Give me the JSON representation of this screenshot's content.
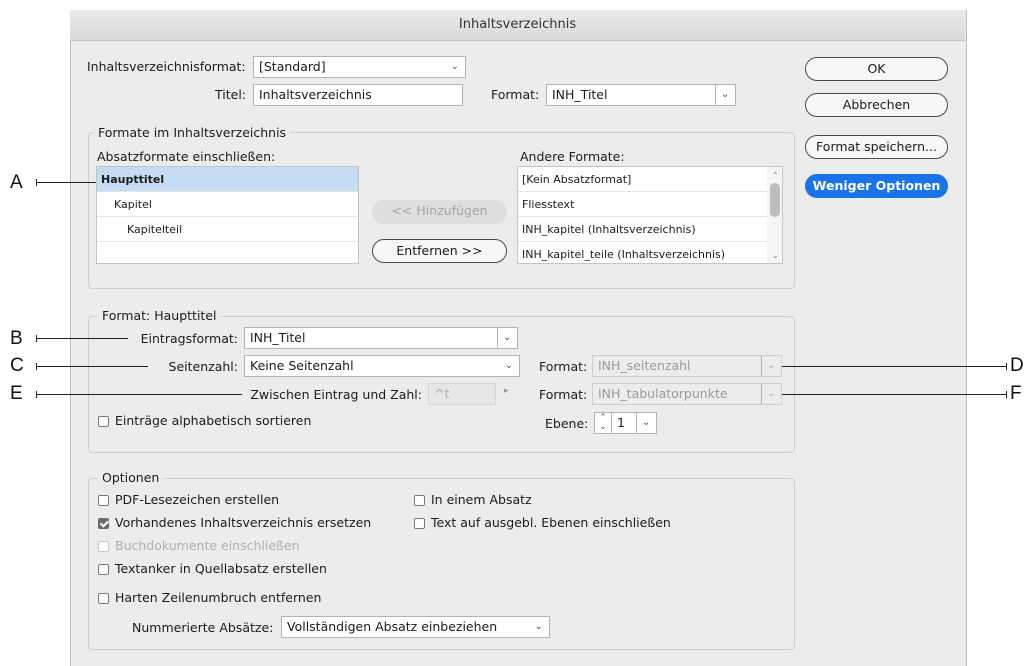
{
  "window": {
    "title": "Inhaltsverzeichnis"
  },
  "top": {
    "format_label": "Inhaltsverzeichnisformat:",
    "format_value": "[Standard]",
    "titel_label": "Titel:",
    "titel_value": "Inhaltsverzeichnis",
    "titel_format_label": "Format:",
    "titel_format_value": "INH_Titel"
  },
  "buttons": {
    "ok": "OK",
    "cancel": "Abbrechen",
    "save_format": "Format speichern...",
    "fewer_options": "Weniger Optionen",
    "add": "<< Hinzufügen",
    "remove": "Entfernen >>"
  },
  "formate": {
    "legend": "Formate im Inhaltsverzeichnis",
    "include_label": "Absatzformate einschließen:",
    "include_items": [
      "Haupttitel",
      "Kapitel",
      "Kapitelteil",
      ""
    ],
    "other_label": "Andere Formate:",
    "other_items": [
      "[Kein Absatzformat]",
      "Fliesstext",
      "INH_kapitel (Inhaltsverzeichnis)",
      "INH_kapitel_teile (Inhaltsverzeichnis)"
    ]
  },
  "format_section": {
    "legend": "Format: Haupttitel",
    "entry_label": "Eintragsformat:",
    "entry_value": "INH_Titel",
    "page_label": "Seitenzahl:",
    "page_value": "Keine Seitenzahl",
    "page_format_label": "Format:",
    "page_format_value": "INH_seitenzahl",
    "between_label": "Zwischen Eintrag und Zahl:",
    "between_value": "^t",
    "between_format_label": "Format:",
    "between_format_value": "INH_tabulatorpunkte",
    "sort_label": "Einträge alphabetisch sortieren",
    "sort_checked": false,
    "level_label": "Ebene:",
    "level_value": "1"
  },
  "options": {
    "legend": "Optionen",
    "pdf_bookmarks": "PDF-Lesezeichen erstellen",
    "replace_existing": "Vorhandenes Inhaltsverzeichnis ersetzen",
    "book_docs": "Buchdokumente einschließen",
    "text_anchor": "Textanker in Quellabsatz erstellen",
    "remove_breaks": "Harten Zeilenumbruch entfernen",
    "run_in": "In einem Absatz",
    "hidden_layers": "Text auf ausgebl. Ebenen einschließen",
    "numbered_label": "Nummerierte Absätze:",
    "numbered_value": "Vollständigen Absatz einbeziehen"
  },
  "callouts": [
    "A",
    "B",
    "C",
    "D",
    "E",
    "F"
  ]
}
